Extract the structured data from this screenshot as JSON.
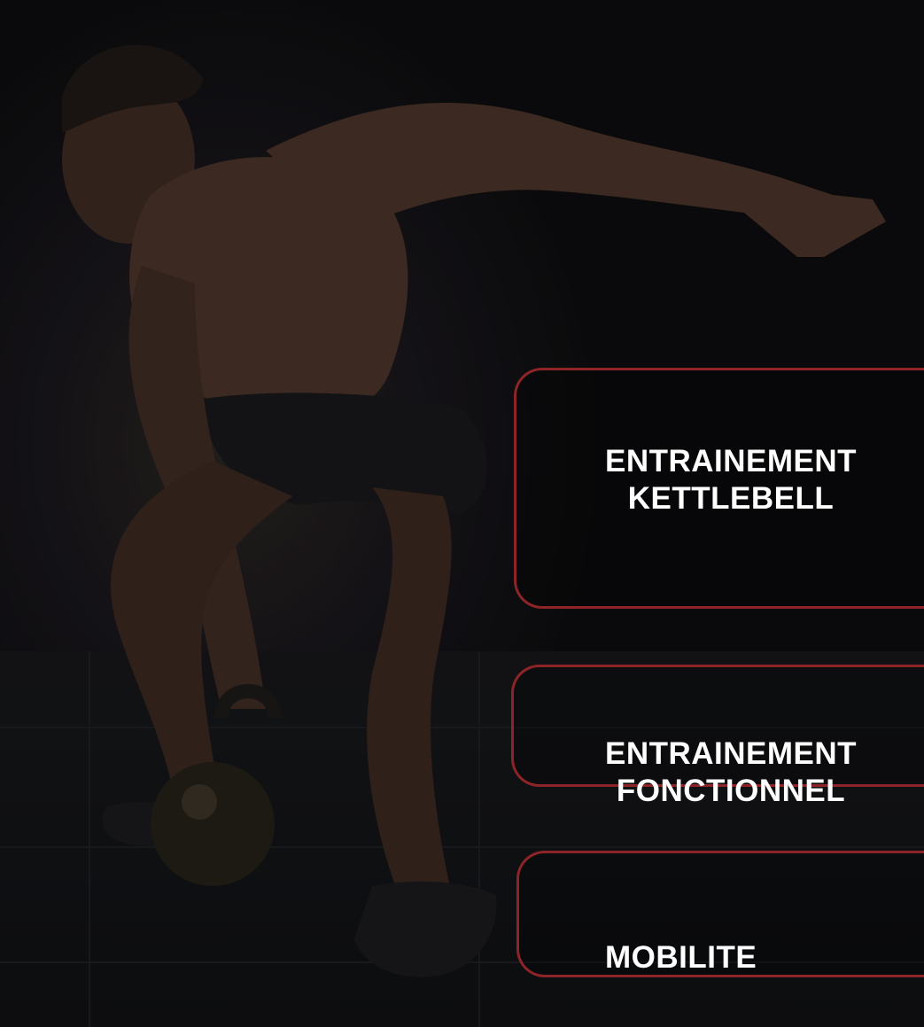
{
  "cards": [
    {
      "line1": "ENTRAINEMENT",
      "line2": "KETTLEBELL"
    },
    {
      "line1": "ENTRAINEMENT",
      "line2": "FONCTIONNEL"
    },
    {
      "line1": "MOBILITE"
    }
  ],
  "colors": {
    "accent": "#8d2427",
    "text": "#ffffff",
    "background": "#0b0b0c"
  }
}
